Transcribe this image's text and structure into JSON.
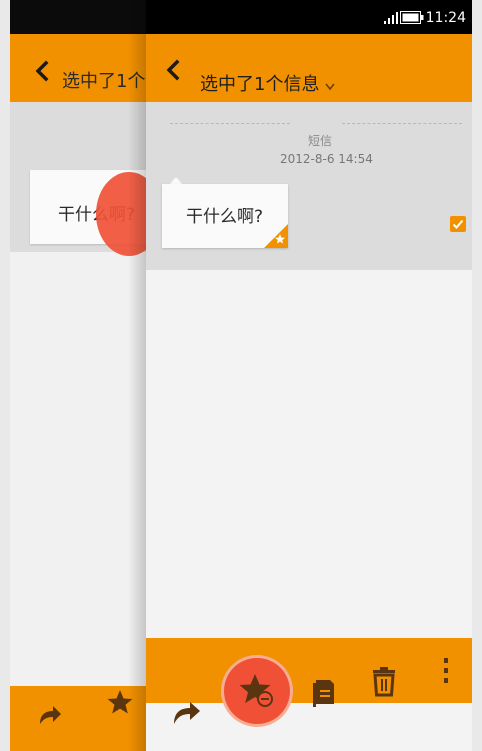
{
  "status_bar": {
    "time": "11:24"
  },
  "header": {
    "title": "选中了1个信息"
  },
  "conversation": {
    "divider_label": "短信",
    "timestamp": "2012-8-6 14:54",
    "message": {
      "text": "干什么啊?",
      "starred": true,
      "selected": true
    }
  },
  "back_screen": {
    "title": "选中了1个",
    "message_text": "干什么啊?"
  },
  "toolbar": {
    "items": [
      "forward-icon",
      "unstar-icon",
      "copy-icon",
      "delete-icon",
      "more-icon"
    ]
  },
  "colors": {
    "accent": "#f29100",
    "highlight": "#f05136",
    "text_dark": "#1f1f1f"
  }
}
